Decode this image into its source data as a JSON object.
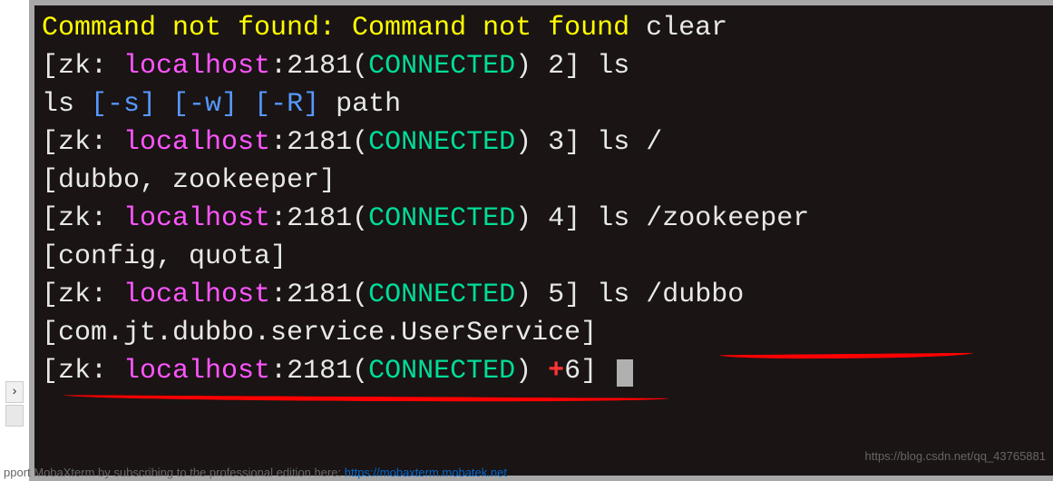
{
  "terminal": {
    "err_prefix": "Command not found: Command not found ",
    "err_cmd": "clear",
    "prompt": {
      "bracket_open": "[",
      "zk": "zk: ",
      "host": "localhost",
      "colon": ":",
      "port": "2181",
      "paren_open": "(",
      "status": "CONNECTED",
      "paren_close": ") ",
      "bracket_close": "] "
    },
    "lines": [
      {
        "seq": "2",
        "cmd": "ls"
      },
      {
        "usage": "ls ",
        "flag1": "[-s]",
        "sp": " ",
        "flag2": "[-w]",
        "flag3": "[-R]",
        "path": " path"
      },
      {
        "seq": "3",
        "cmd": "ls /"
      },
      {
        "result": "[dubbo, zookeeper]"
      },
      {
        "seq": "4",
        "cmd": "ls /zookeeper"
      },
      {
        "result": "[config, quota]"
      },
      {
        "seq": "5",
        "cmd": "ls ",
        "cmd2": "/dubbo"
      },
      {
        "result": "[com.jt.dubbo.service.UserService]"
      },
      {
        "seq": "6",
        "plus": "+"
      }
    ]
  },
  "footer": {
    "text": "pport MobaXterm by subscribing to the professional edition here: ",
    "link": "https://mobaxterm.mobatek.net"
  },
  "watermark": "https://blog.csdn.net/qq_43765881"
}
